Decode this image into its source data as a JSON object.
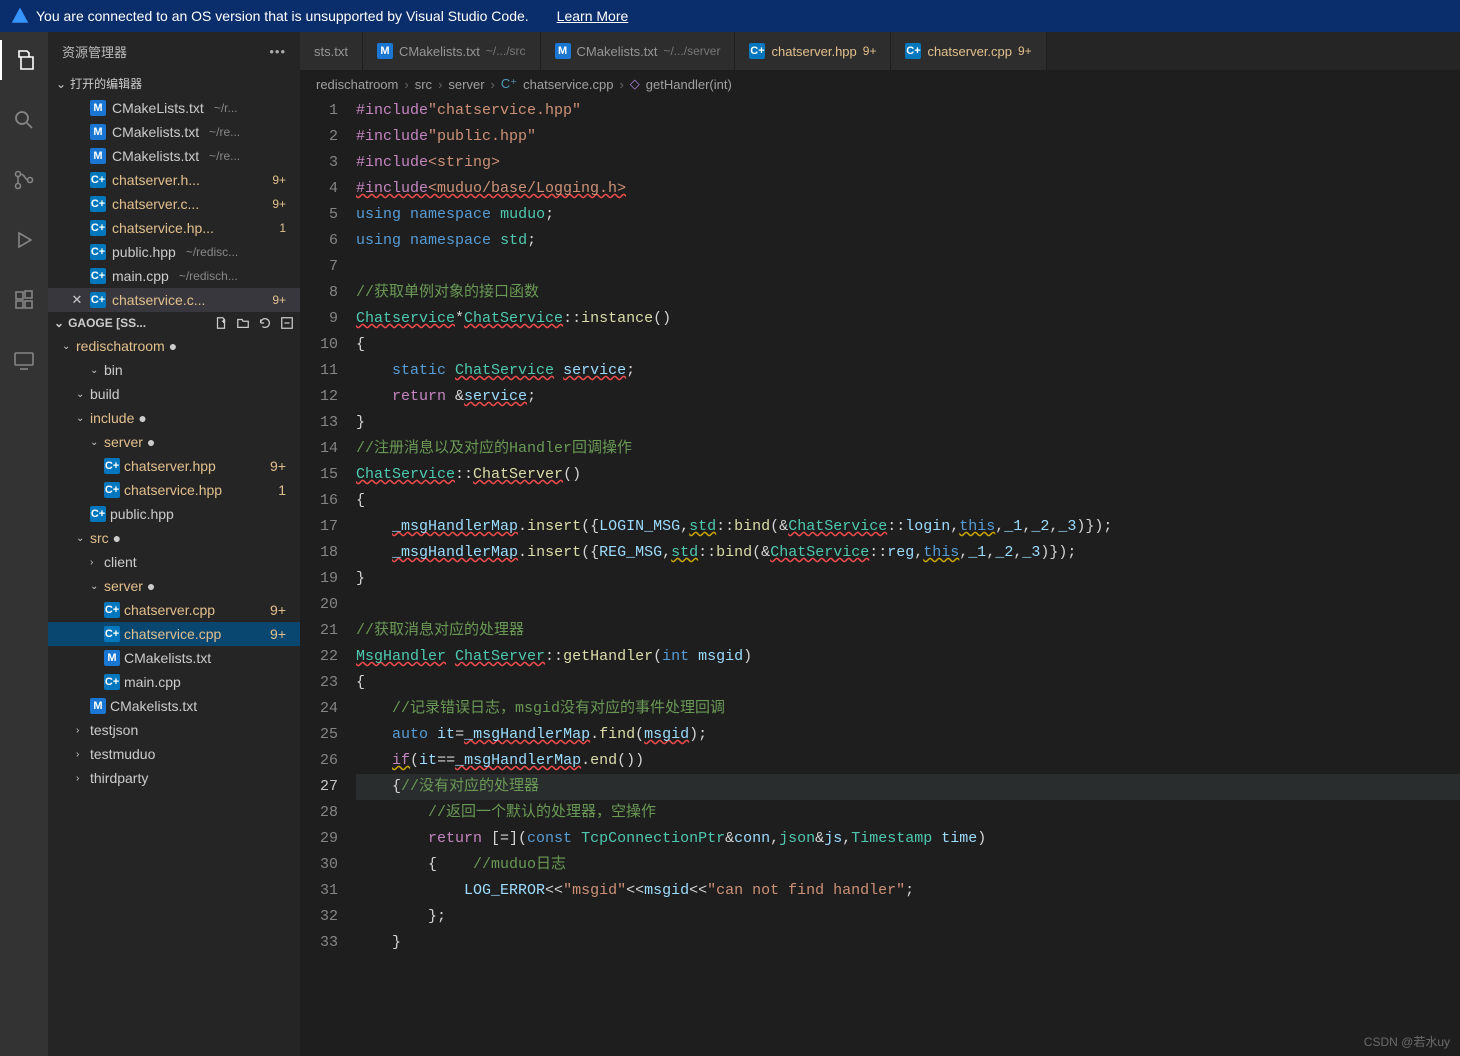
{
  "banner": {
    "text": "You are connected to an OS version that is unsupported by Visual Studio Code.",
    "link": "Learn More"
  },
  "sidebar": {
    "title": "资源管理器",
    "openEditors": {
      "label": "打开的编辑器",
      "items": [
        {
          "icon": "M",
          "name": "CMakeLists.txt",
          "path": "~/r...",
          "mod": false,
          "badge": ""
        },
        {
          "icon": "M",
          "name": "CMakelists.txt",
          "path": "~/re...",
          "mod": false,
          "badge": ""
        },
        {
          "icon": "M",
          "name": "CMakelists.txt",
          "path": "~/re...",
          "mod": false,
          "badge": ""
        },
        {
          "icon": "C+",
          "name": "chatserver.h...",
          "path": "",
          "mod": true,
          "badge": "9+"
        },
        {
          "icon": "C+",
          "name": "chatserver.c...",
          "path": "",
          "mod": true,
          "badge": "9+"
        },
        {
          "icon": "C+",
          "name": "chatservice.hp...",
          "path": "",
          "mod": true,
          "badge": "1"
        },
        {
          "icon": "C+",
          "name": "public.hpp",
          "path": "~/redisc...",
          "mod": false,
          "badge": ""
        },
        {
          "icon": "C+",
          "name": "main.cpp",
          "path": "~/redisch...",
          "mod": false,
          "badge": ""
        },
        {
          "icon": "C+",
          "name": "chatservice.c...",
          "path": "",
          "mod": true,
          "badge": "9+",
          "active": true
        }
      ]
    },
    "workspace": {
      "label": "GAOGE [SS...",
      "root": "redischatroom",
      "treeflat": [
        {
          "d": 2,
          "chev": "v",
          "name": "bin"
        },
        {
          "d": 1,
          "chev": "v",
          "name": "build"
        },
        {
          "d": 1,
          "chev": "v",
          "name": "include",
          "mod": true
        },
        {
          "d": 2,
          "chev": "v",
          "name": "server",
          "mod": true
        },
        {
          "d": 3,
          "icon": "C+",
          "name": "chatserver.hpp",
          "mod": true,
          "badge": "9+"
        },
        {
          "d": 3,
          "icon": "C+",
          "name": "chatservice.hpp",
          "mod": true,
          "badge": "1"
        },
        {
          "d": 2,
          "icon": "C+",
          "name": "public.hpp"
        },
        {
          "d": 1,
          "chev": "v",
          "name": "src",
          "mod": true
        },
        {
          "d": 2,
          "chev": ">",
          "name": "client"
        },
        {
          "d": 2,
          "chev": "v",
          "name": "server",
          "mod": true
        },
        {
          "d": 3,
          "icon": "C+",
          "name": "chatserver.cpp",
          "mod": true,
          "badge": "9+"
        },
        {
          "d": 3,
          "icon": "C+",
          "name": "chatservice.cpp",
          "mod": true,
          "badge": "9+",
          "selected": true
        },
        {
          "d": 3,
          "icon": "M",
          "name": "CMakelists.txt"
        },
        {
          "d": 3,
          "icon": "C+",
          "name": "main.cpp"
        },
        {
          "d": 2,
          "icon": "M",
          "name": "CMakelists.txt"
        },
        {
          "d": 1,
          "chev": ">",
          "name": "testjson"
        },
        {
          "d": 1,
          "chev": ">",
          "name": "testmuduo"
        },
        {
          "d": 1,
          "chev": ">",
          "name": "thirdparty"
        }
      ]
    }
  },
  "tabs": [
    {
      "icon": "",
      "label": "sts.txt",
      "path": "",
      "mod": false,
      "badge": ""
    },
    {
      "icon": "M",
      "label": "CMakelists.txt",
      "path": "~/.../src",
      "mod": false,
      "badge": ""
    },
    {
      "icon": "M",
      "label": "CMakelists.txt",
      "path": "~/.../server",
      "mod": false,
      "badge": ""
    },
    {
      "icon": "C+",
      "label": "chatserver.hpp",
      "path": "",
      "mod": true,
      "badge": "9+"
    },
    {
      "icon": "C+",
      "label": "chatserver.cpp",
      "path": "",
      "mod": true,
      "badge": "9+"
    }
  ],
  "breadcrumb": {
    "parts": [
      "redischatroom",
      "src",
      "server",
      "chatservice.cpp",
      "getHandler(int)"
    ]
  },
  "code": {
    "startLine": 1,
    "activeLine": 27,
    "lines": [
      {
        "t": "#include\"chatservice.hpp\"",
        "kind": "inc-q"
      },
      {
        "t": "#include\"public.hpp\"",
        "kind": "inc-q"
      },
      {
        "t": "#include<string>",
        "kind": "inc-a"
      },
      {
        "t": "#include<muduo/base/Logging.h>",
        "kind": "inc-a-wavy"
      },
      {
        "t": "using namespace muduo;",
        "kind": "using",
        "ns": "muduo"
      },
      {
        "t": "using namespace std;",
        "kind": "using",
        "ns": "std"
      },
      {
        "t": "",
        "kind": "blank"
      },
      {
        "t": "//获取单例对象的接口函数",
        "kind": "cmt"
      },
      {
        "t": "Chatservice*ChatService::instance()",
        "kind": "raw",
        "raw": "<span class='tk-type wavy-r'>Chatservice</span>*<span class='tk-type wavy-r'>ChatService</span>::<span class='tk-fn'>instance</span>()"
      },
      {
        "t": "{",
        "kind": "plain"
      },
      {
        "t": "    static ChatService service;",
        "kind": "raw",
        "raw": "    <span class='tk-kw'>static</span> <span class='tk-type wavy-r'>ChatService</span> <span class='tk-var wavy-r'>service</span>;"
      },
      {
        "t": "    return &service;",
        "kind": "raw",
        "raw": "    <span class='tk-kw2'>return</span> &amp;<span class='tk-var wavy-r'>service</span>;"
      },
      {
        "t": "}",
        "kind": "plain"
      },
      {
        "t": "//注册消息以及对应的Handler回调操作",
        "kind": "cmt"
      },
      {
        "t": "ChatService::ChatServer()",
        "kind": "raw",
        "raw": "<span class='tk-type wavy-r'>ChatService</span>::<span class='tk-fn wavy-r'>ChatServer</span>()"
      },
      {
        "t": "{",
        "kind": "plain"
      },
      {
        "t": "    _msgHandlerMap.insert({LOGIN_MSG,std::bind(&ChatService::login,this,_1,_2,_3)});",
        "kind": "raw",
        "raw": "    <span class='tk-var wavy-r'>_msgHandlerMap</span>.<span class='tk-fn'>insert</span>({<span class='tk-var'>LOGIN_MSG</span>,<span class='tk-type wavy-y'>std</span>::<span class='tk-fn'>bind</span>(&amp;<span class='tk-type wavy-r'>ChatService</span>::<span class='tk-var'>login</span>,<span class='tk-kw wavy-y'>this</span>,<span class='tk-var'>_1</span>,<span class='tk-var'>_2</span>,<span class='tk-var'>_3</span>)});"
      },
      {
        "t": "    _msgHandlerMap.insert({REG_MSG,std::bind(&ChatService::reg,this,_1,_2,_3)});",
        "kind": "raw",
        "raw": "    <span class='tk-var wavy-r'>_msgHandlerMap</span>.<span class='tk-fn'>insert</span>({<span class='tk-var'>REG_MSG</span>,<span class='tk-type wavy-y'>std</span>::<span class='tk-fn'>bind</span>(&amp;<span class='tk-type wavy-r'>ChatService</span>::<span class='tk-var'>reg</span>,<span class='tk-kw wavy-y'>this</span>,<span class='tk-var'>_1</span>,<span class='tk-var'>_2</span>,<span class='tk-var'>_3</span>)});"
      },
      {
        "t": "}",
        "kind": "plain"
      },
      {
        "t": "",
        "kind": "blank"
      },
      {
        "t": "//获取消息对应的处理器",
        "kind": "cmt"
      },
      {
        "t": "MsgHandler ChatServer::getHandler(int msgid)",
        "kind": "raw",
        "raw": "<span class='tk-type wavy-r'>MsgHandler</span> <span class='tk-type wavy-r'>ChatServer</span>::<span class='tk-fn'>getHandler</span>(<span class='tk-kw'>int</span> <span class='tk-var'>msgid</span>)"
      },
      {
        "t": "{",
        "kind": "plain"
      },
      {
        "t": "    //记录错误日志，msgid没有对应的事件处理回调",
        "kind": "cmt-ind"
      },
      {
        "t": "    auto it=_msgHandlerMap.find(msgid);",
        "kind": "raw",
        "raw": "    <span class='tk-kw'>auto</span> <span class='tk-var'>it</span>=<span class='tk-var wavy-r'>_msgHandlerMap</span>.<span class='tk-fn'>find</span>(<span class='tk-var wavy-r'>msgid</span>);"
      },
      {
        "t": "    if(it==_msgHandlerMap.end())",
        "kind": "raw",
        "raw": "    <span class='tk-kw2 wavy-y'>if</span>(<span class='tk-var'>it</span>==<span class='tk-var wavy-r'>_msgHandlerMap</span>.<span class='tk-fn'>end</span>())"
      },
      {
        "t": "    {//没有对应的处理器",
        "kind": "raw",
        "raw": "    {<span class='tk-cmt'>//没有对应的处理器</span>"
      },
      {
        "t": "        //返回一个默认的处理器，空操作",
        "kind": "cmt-ind2"
      },
      {
        "t": "        return [=](const TcpConnectionPtr&conn,json&js,Timestamp time)",
        "kind": "raw",
        "raw": "        <span class='tk-kw2'>return</span> [=](<span class='tk-kw'>const</span> <span class='tk-type'>TcpConnectionPtr</span>&amp;<span class='tk-var'>conn</span>,<span class='tk-type'>json</span>&amp;<span class='tk-var'>js</span>,<span class='tk-type'>Timestamp</span> <span class='tk-var'>time</span>)"
      },
      {
        "t": "        {    //muduo日志",
        "kind": "raw",
        "raw": "        {    <span class='tk-cmt'>//muduo日志</span>"
      },
      {
        "t": "            LOG_ERROR<<\"msgid\"<<msgid<<\"can not find handler\";",
        "kind": "raw",
        "raw": "            <span class='tk-var'>LOG_ERROR</span>&lt;&lt;<span class='tk-str'>\"msgid\"</span>&lt;&lt;<span class='tk-var'>msgid</span>&lt;&lt;<span class='tk-str'>\"can not find handler\"</span>;"
      },
      {
        "t": "        };",
        "kind": "plain"
      },
      {
        "t": "    }",
        "kind": "plain"
      }
    ]
  },
  "watermark": "CSDN @若水uy"
}
